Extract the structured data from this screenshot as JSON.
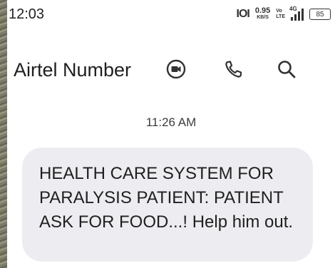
{
  "status_bar": {
    "time": "12:03",
    "vibrate": "IOI",
    "net_speed_value": "0.95",
    "net_speed_unit": "KB/S",
    "volte_top": "Vo",
    "volte_bottom": "LTE",
    "network_type": "4G",
    "battery": "85"
  },
  "header": {
    "contact_name": "Airtel Number",
    "icons": [
      "video-call-icon",
      "phone-icon",
      "search-icon"
    ]
  },
  "conversation": {
    "timestamp": "11:26 AM",
    "messages": [
      {
        "text": "HEALTH CARE SYSTEM FOR PARALYSIS PATIENT: PATIENT ASK FOR FOOD...! Help him out.",
        "direction": "incoming"
      }
    ]
  },
  "colors": {
    "bubble": "#ededf1",
    "text": "#1f1f1f",
    "background": "#ffffff"
  }
}
